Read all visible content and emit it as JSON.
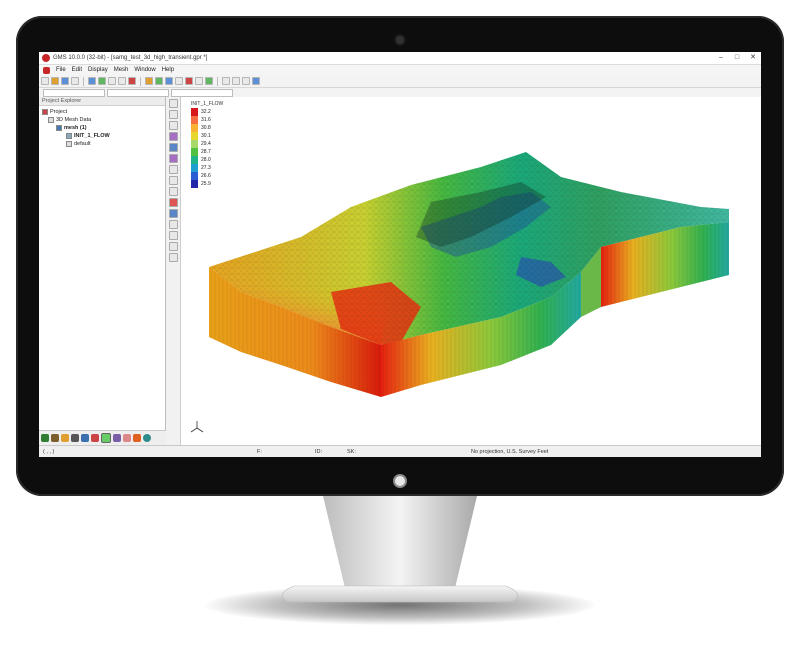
{
  "window": {
    "title": "GMS 10.0.0 (32-bit) - [samg_test_3d_high_transient.gpr *]",
    "minimize": "–",
    "maximize": "□",
    "close": "✕"
  },
  "menu": [
    {
      "label": "File"
    },
    {
      "label": "Edit"
    },
    {
      "label": "Display"
    },
    {
      "label": "Mesh"
    },
    {
      "label": "Window"
    },
    {
      "label": "Help"
    }
  ],
  "explorer": {
    "title": "Project Explorer",
    "items": [
      {
        "label": "Project",
        "icon": "project-icon"
      },
      {
        "label": "3D Mesh Data",
        "icon": "folder-icon"
      },
      {
        "label": "mesh (1)",
        "icon": "mesh-icon"
      },
      {
        "label": "INIT_1_FLOW",
        "icon": "dataset-icon"
      },
      {
        "label": "default",
        "icon": "material-icon"
      }
    ]
  },
  "legend": {
    "title": "INIT_1_FLOW",
    "entries": [
      {
        "label": "32.2",
        "color": "#d7191c"
      },
      {
        "label": "31.6",
        "color": "#f46d43"
      },
      {
        "label": "30.8",
        "color": "#f9b234"
      },
      {
        "label": "30.1",
        "color": "#e6d72a"
      },
      {
        "label": "29.4",
        "color": "#a6d96a"
      },
      {
        "label": "28.7",
        "color": "#50c040"
      },
      {
        "label": "28.0",
        "color": "#1db48a"
      },
      {
        "label": "27.3",
        "color": "#1f9fd0"
      },
      {
        "label": "26.6",
        "color": "#2a5cd6"
      },
      {
        "label": "25.9",
        "color": "#2326a8"
      }
    ]
  },
  "status": {
    "coords": "( , , )",
    "f": "F:",
    "id": "ID:",
    "sk": "SK:",
    "projection": "No projection, U.S. Survey Feet"
  }
}
